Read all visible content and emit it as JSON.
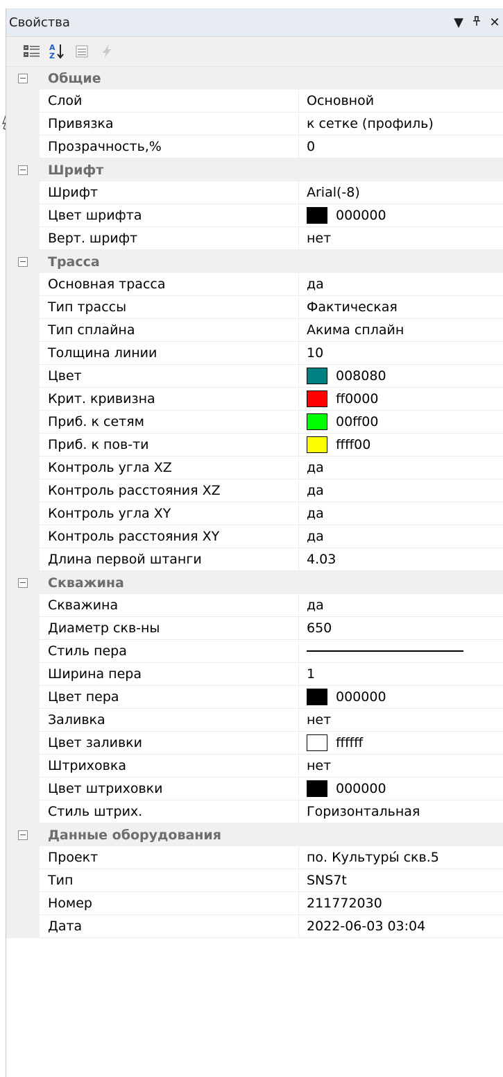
{
  "window": {
    "title": "Свойства",
    "buttons": {
      "dropdown": "▼",
      "pin": "ᵺ",
      "close": "✕"
    }
  },
  "toolbar": {
    "tools": [
      "categorized-icon",
      "alphabetical-sort-icon",
      "property-pages-icon",
      "events-icon"
    ]
  },
  "categories": [
    {
      "name": "Общие",
      "rows": [
        {
          "name": "Слой",
          "value": "Основной"
        },
        {
          "name": "Привязка",
          "value": "к сетке (профиль)"
        },
        {
          "name": "Прозрачность,%",
          "value": "0"
        }
      ]
    },
    {
      "name": "Шрифт",
      "rows": [
        {
          "name": "Шрифт",
          "value": "Arial(-8)"
        },
        {
          "name": "Цвет шрифта",
          "value": "000000",
          "color": "#000000"
        },
        {
          "name": "Верт. шрифт",
          "value": "нет"
        }
      ]
    },
    {
      "name": "Трасса",
      "rows": [
        {
          "name": "Основная трасса",
          "value": "да"
        },
        {
          "name": "Тип трассы",
          "value": "Фактическая"
        },
        {
          "name": "Тип сплайна",
          "value": "Акима сплайн"
        },
        {
          "name": "Толщина линии",
          "value": "10"
        },
        {
          "name": "Цвет",
          "value": "008080",
          "color": "#008080"
        },
        {
          "name": "Крит. кривизна",
          "value": "ff0000",
          "color": "#ff0000"
        },
        {
          "name": "Приб. к сетям",
          "value": "00ff00",
          "color": "#00ff00"
        },
        {
          "name": "Приб. к пов-ти",
          "value": "ffff00",
          "color": "#ffff00"
        },
        {
          "name": "Контроль угла XZ",
          "value": "да"
        },
        {
          "name": "Контроль расстояния XZ",
          "value": "да"
        },
        {
          "name": "Контроль угла XY",
          "value": "да"
        },
        {
          "name": "Контроль расстояния XY",
          "value": "да"
        },
        {
          "name": "Длина первой штанги",
          "value": "4.03"
        }
      ]
    },
    {
      "name": "Скважина",
      "rows": [
        {
          "name": "Скважина",
          "value": "да"
        },
        {
          "name": "Диаметр скв-ны",
          "value": "650"
        },
        {
          "name": "Стиль пера",
          "value": "",
          "penline": true
        },
        {
          "name": "Ширина пера",
          "value": "1"
        },
        {
          "name": "Цвет пера",
          "value": "000000",
          "color": "#000000"
        },
        {
          "name": "Заливка",
          "value": "нет"
        },
        {
          "name": "Цвет заливки",
          "value": "ffffff",
          "color": "#ffffff"
        },
        {
          "name": "Штриховка",
          "value": "нет"
        },
        {
          "name": "Цвет штриховки",
          "value": "000000",
          "color": "#000000"
        },
        {
          "name": "Стиль штрих.",
          "value": "Горизонтальная"
        }
      ]
    },
    {
      "name": "Данные оборудования",
      "rows": [
        {
          "name": "Проект",
          "value": "по. Культуры́ скв.5"
        },
        {
          "name": "Тип",
          "value": "SNS7t"
        },
        {
          "name": "Номер",
          "value": " 211772030"
        },
        {
          "name": "Дата",
          "value": "2022-06-03 03:04"
        }
      ]
    }
  ]
}
